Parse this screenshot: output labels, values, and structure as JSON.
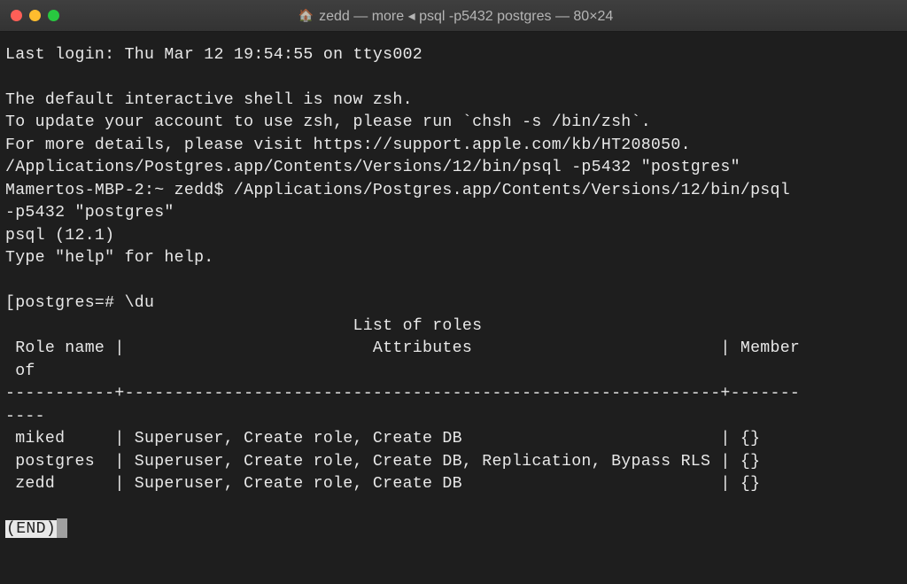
{
  "window": {
    "title": "zedd — more ◂ psql -p5432 postgres — 80×24"
  },
  "terminal": {
    "last_login": "Last login: Thu Mar 12 19:54:55 on ttys002",
    "zsh_notice_1": "The default interactive shell is now zsh.",
    "zsh_notice_2": "To update your account to use zsh, please run `chsh -s /bin/zsh`.",
    "zsh_notice_3": "For more details, please visit https://support.apple.com/kb/HT208050.",
    "cmd_echo": "/Applications/Postgres.app/Contents/Versions/12/bin/psql -p5432 \"postgres\"",
    "prompt_line_1": "Mamertos-MBP-2:~ zedd$ /Applications/Postgres.app/Contents/Versions/12/bin/psql ",
    "prompt_line_2": "-p5432 \"postgres\"",
    "psql_version": "psql (12.1)",
    "psql_help": "Type \"help\" for help.",
    "psql_prompt": "[postgres=# \\du",
    "table_title": "                                   List of roles",
    "table_header": " Role name |                         Attributes                         | Member",
    "table_header_2": " of",
    "table_sep": "-----------+------------------------------------------------------------+-------",
    "table_sep_2": "----",
    "row_miked": " miked     | Superuser, Create role, Create DB                          | {}",
    "row_postgres": " postgres  | Superuser, Create role, Create DB, Replication, Bypass RLS | {}",
    "row_zedd": " zedd      | Superuser, Create role, Create DB                          | {}",
    "end_label": "(END)"
  },
  "roles": [
    {
      "name": "miked",
      "attributes": "Superuser, Create role, Create DB",
      "member_of": "{}"
    },
    {
      "name": "postgres",
      "attributes": "Superuser, Create role, Create DB, Replication, Bypass RLS",
      "member_of": "{}"
    },
    {
      "name": "zedd",
      "attributes": "Superuser, Create role, Create DB",
      "member_of": "{}"
    }
  ]
}
